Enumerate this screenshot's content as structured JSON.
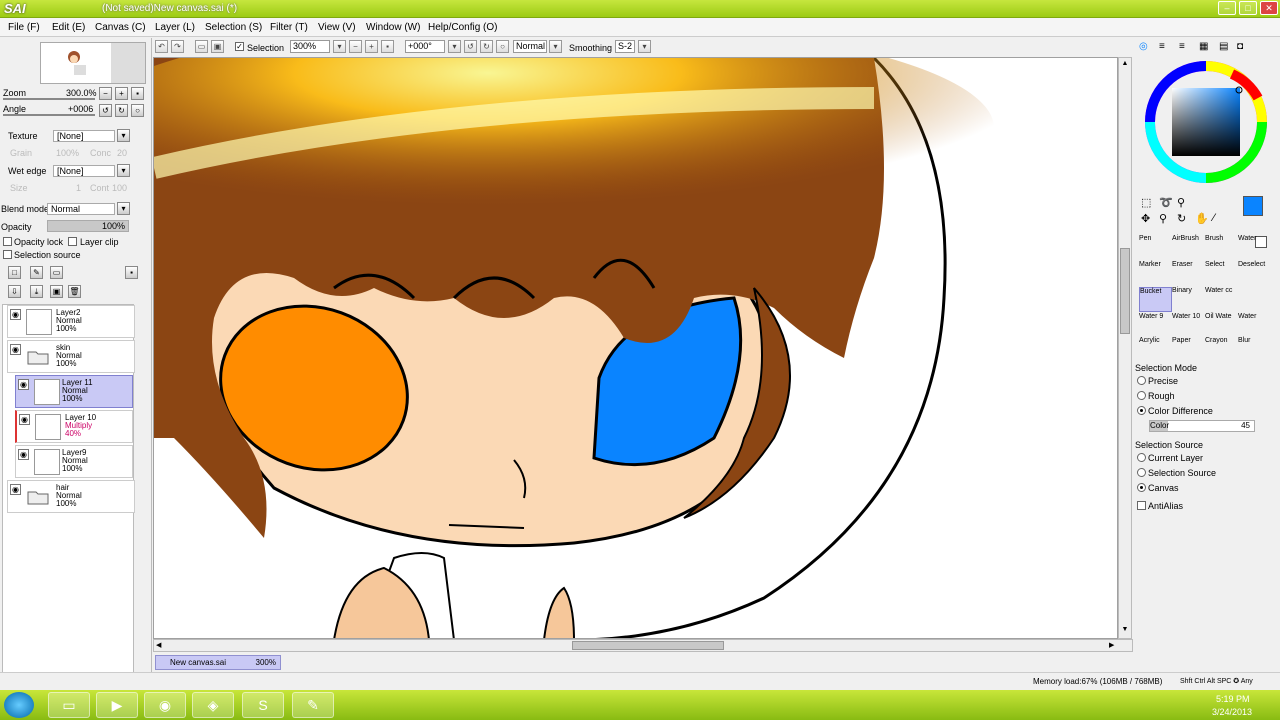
{
  "app": {
    "logo": "SAI",
    "logo_prefix": "Paint Tool",
    "title": "(Not saved)New canvas.sai (*)"
  },
  "window_controls": {
    "minimize": "–",
    "maximize": "□",
    "close": "✕"
  },
  "menu": [
    "File (F)",
    "Edit (E)",
    "Canvas (C)",
    "Layer (L)",
    "Selection (S)",
    "Filter (T)",
    "View (V)",
    "Window (W)",
    "Help/Config (O)"
  ],
  "toolbar": {
    "selection_label": "Selection",
    "selection_checked": true,
    "zoom": "300%",
    "angle": "+000°",
    "blend": "Normal",
    "smoothing_label": "Smoothing",
    "smoothing": "S-2"
  },
  "navigator": {
    "zoom_label": "Zoom",
    "zoom_value": "300.0%",
    "angle_label": "Angle",
    "angle_value": "+0006"
  },
  "texture": {
    "label": "Texture",
    "value": "[None]",
    "grain": "Grain",
    "grain_val": "100%",
    "conc": "Conc",
    "conc_val": "20"
  },
  "wet_edge": {
    "label": "Wet edge",
    "value": "[None]",
    "size": "Size",
    "size_val": "1",
    "cont": "Cont",
    "cont_val": "100"
  },
  "blend_mode": {
    "label": "Blend mode",
    "value": "Normal"
  },
  "opacity": {
    "label": "Opacity",
    "value": "100%"
  },
  "checks": {
    "opacity_lock": "Opacity lock",
    "layer_clip": "Layer clip",
    "selection_source": "Selection source"
  },
  "layers": [
    {
      "name": "Layer2",
      "mode": "Normal",
      "opacity": "100%",
      "type": "layer",
      "selected": false
    },
    {
      "name": "skin",
      "mode": "Normal",
      "opacity": "100%",
      "type": "folder",
      "selected": false
    },
    {
      "name": "Layer 11",
      "mode": "Normal",
      "opacity": "100%",
      "type": "layer",
      "selected": true
    },
    {
      "name": "Layer 10",
      "mode": "Multiply",
      "opacity": "40%",
      "type": "layer",
      "selected": false
    },
    {
      "name": "Layer9",
      "mode": "Normal",
      "opacity": "100%",
      "type": "layer",
      "selected": false
    },
    {
      "name": "hair",
      "mode": "Normal",
      "opacity": "100%",
      "type": "folder",
      "selected": false
    }
  ],
  "tab": {
    "name": "New canvas.sai",
    "zoom": "300%"
  },
  "colors": {
    "primary": "#0a84ff",
    "accent": "#c9c9f5",
    "eye_blue": "#0a84ff",
    "cheek_orange": "#ff8c00",
    "hair_brown": "#8b4513",
    "skin": "#fbd9b5"
  },
  "tools": [
    [
      "Pen",
      "AirBrush",
      "Brush",
      "Water"
    ],
    [
      "Marker",
      "Eraser",
      "Select",
      "Deselect"
    ],
    [
      "Bucket",
      "Binary",
      "Water cc",
      ""
    ],
    [
      "Water 9",
      "Water 10",
      "Oil Wate",
      "Water"
    ],
    [
      "Acrylic",
      "Paper",
      "Crayon",
      "Blur"
    ]
  ],
  "selected_tool": "Bucket",
  "selection_mode": {
    "title": "Selection Mode",
    "options": [
      "Precise",
      "Rough",
      "Color Difference"
    ],
    "selected": 2,
    "color_label": "Color",
    "color_value": "45"
  },
  "selection_source": {
    "title": "Selection Source",
    "options": [
      "Current Layer",
      "Selection Source",
      "Canvas"
    ],
    "selected": 2
  },
  "antialias": "AntiAlias",
  "status": {
    "memory": "Memory load:67% (106MB / 768MB)",
    "keys": "Shft Ctrl Alt SPC ✪ Any"
  },
  "clock": {
    "time": "5:19 PM",
    "date": "3/24/2013"
  },
  "taskbar_icons": [
    "folder-icon",
    "media-icon",
    "chrome-icon",
    "paint-icon",
    "skype-icon",
    "sai-icon"
  ]
}
